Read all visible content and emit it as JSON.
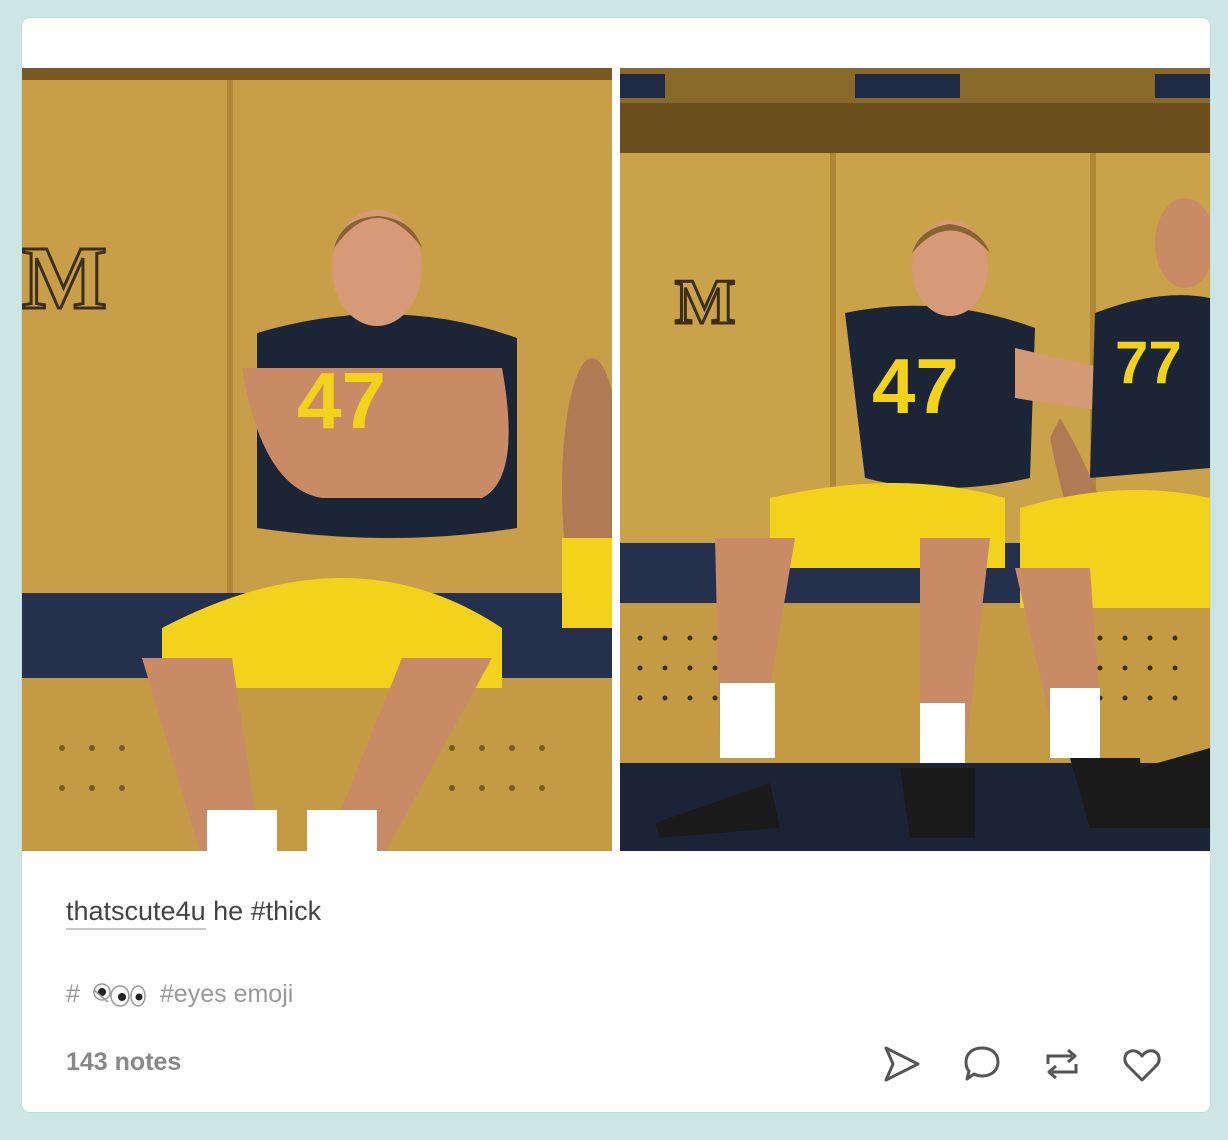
{
  "post": {
    "photos": [
      {
        "name": "photo-left",
        "jersey_number": "47"
      },
      {
        "name": "photo-right",
        "jersey_number": "47"
      }
    ],
    "caption": {
      "username": "thatscute4u",
      "text": " he #thick"
    },
    "tags": [
      {
        "prefix": "#",
        "icon": "eyes-emoji-icon"
      },
      {
        "label": "#eyes emoji"
      }
    ],
    "notes": "143 notes",
    "actions": [
      {
        "name": "share-button",
        "icon": "paper-plane-icon"
      },
      {
        "name": "reply-button",
        "icon": "speech-bubble-icon"
      },
      {
        "name": "reblog-button",
        "icon": "reblog-icon"
      },
      {
        "name": "like-button",
        "icon": "heart-icon"
      }
    ]
  },
  "colors": {
    "page_background": "#cce6e6",
    "card": "#ffffff",
    "locker_wall": "#c9a24a",
    "jersey_navy": "#1c2536",
    "pants_yellow": "#f2d21a",
    "bench": "#1f2a44"
  }
}
